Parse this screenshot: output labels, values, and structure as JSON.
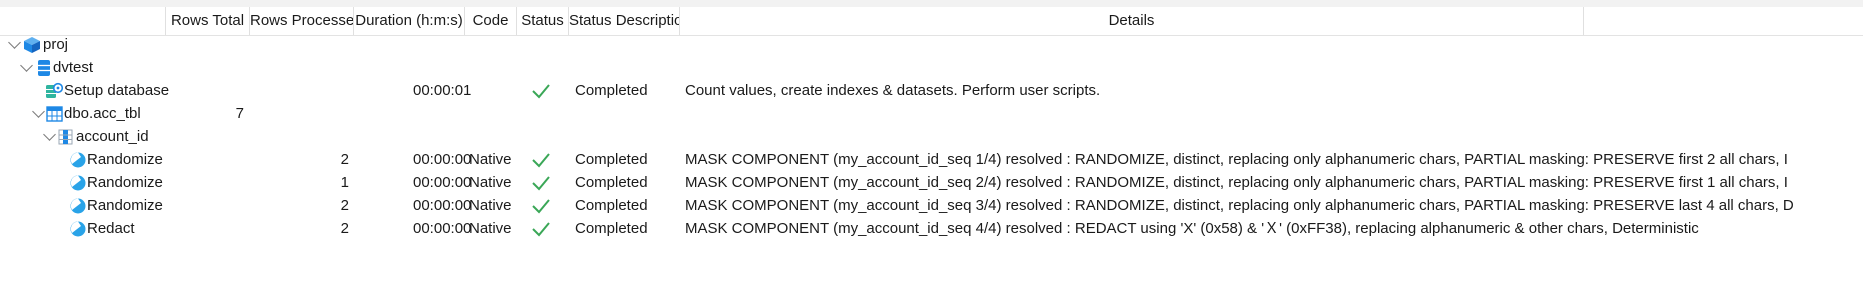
{
  "columns": {
    "rows_total": "Rows Total",
    "rows_processed": "Rows Processed",
    "duration": "Duration (h:m:s)",
    "code": "Code",
    "status": "Status",
    "status_description": "Status Description",
    "details": "Details"
  },
  "tree": [
    {
      "name": "proj",
      "icon": "cube-icon",
      "level": 0,
      "expanded": true
    },
    {
      "name": "dvtest",
      "icon": "database-icon",
      "level": 1,
      "expanded": true
    },
    {
      "name": "Setup database",
      "icon": "setup-database-icon",
      "level": 2,
      "duration": "00:00:01",
      "status": "check-icon",
      "status_description": "Completed",
      "details": "Count values, create indexes & datasets. Perform user scripts."
    },
    {
      "name": "dbo.acc_tbl",
      "icon": "table-icon",
      "level": 2,
      "expanded": true,
      "rows_total": "7"
    },
    {
      "name": "account_id",
      "icon": "column-icon",
      "level": 3,
      "expanded": true
    },
    {
      "name": "Randomize",
      "icon": "mask-function-icon",
      "level": 4,
      "rows_processed": "2",
      "duration": "00:00:00",
      "code": "Native",
      "status": "check-icon",
      "status_description": "Completed",
      "details": "MASK COMPONENT (my_account_id_seq 1/4) resolved : RANDOMIZE, distinct, replacing only alphanumeric chars, PARTIAL masking: PRESERVE first 2 all chars, I"
    },
    {
      "name": "Randomize",
      "icon": "mask-function-icon",
      "level": 4,
      "rows_processed": "1",
      "duration": "00:00:00",
      "code": "Native",
      "status": "check-icon",
      "status_description": "Completed",
      "details": "MASK COMPONENT (my_account_id_seq 2/4) resolved : RANDOMIZE, distinct, replacing only alphanumeric chars, PARTIAL masking: PRESERVE first 1 all chars, I"
    },
    {
      "name": "Randomize",
      "icon": "mask-function-icon",
      "level": 4,
      "rows_processed": "2",
      "duration": "00:00:00",
      "code": "Native",
      "status": "check-icon",
      "status_description": "Completed",
      "details": "MASK COMPONENT (my_account_id_seq 3/4) resolved : RANDOMIZE, distinct, replacing only alphanumeric chars, PARTIAL masking: PRESERVE last 4 all chars, D"
    },
    {
      "name": "Redact",
      "icon": "mask-function-icon",
      "level": 4,
      "rows_processed": "2",
      "duration": "00:00:00",
      "code": "Native",
      "status": "check-icon",
      "status_description": "Completed",
      "details": "MASK COMPONENT (my_account_id_seq 4/4) resolved : REDACT using 'X' (0x58) & 'Ｘ' (0xFF38), replacing alphanumeric & other chars, Deterministic"
    }
  ],
  "colors": {
    "check": "#3aa757",
    "cube": "#1e88e5",
    "database": "#1e88e5",
    "table": "#1e88e5",
    "mask": "#29a3e8"
  }
}
